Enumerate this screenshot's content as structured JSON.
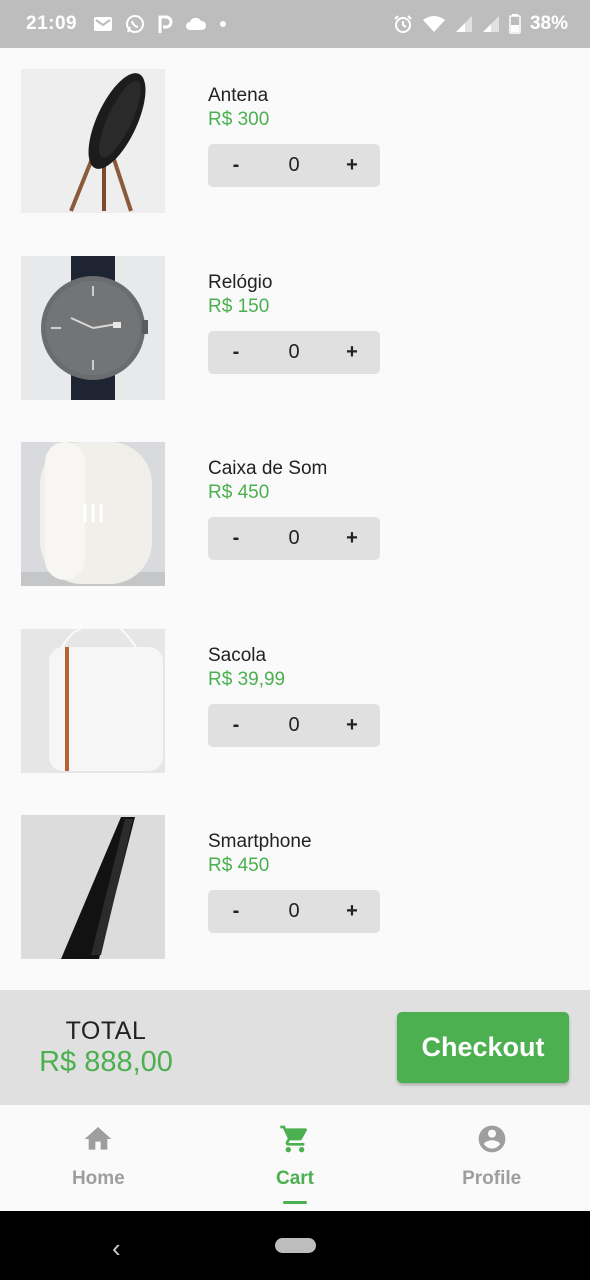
{
  "status_bar": {
    "time": "21:09",
    "battery_percent": "38%",
    "left_icons": [
      "gmail-icon",
      "whatsapp-icon",
      "p-app-icon",
      "cloud-icon",
      "dot-icon"
    ],
    "right_icons": [
      "alarm-icon",
      "wifi-icon",
      "signal-icon",
      "signal-icon",
      "battery-icon"
    ]
  },
  "products": [
    {
      "name": "Antena",
      "price": "R$ 300",
      "quantity": "0",
      "minus": "-",
      "plus": "+"
    },
    {
      "name": "Relógio",
      "price": "R$ 150",
      "quantity": "0",
      "minus": "-",
      "plus": "+"
    },
    {
      "name": "Caixa de Som",
      "price": "R$ 450",
      "quantity": "0",
      "minus": "-",
      "plus": "+"
    },
    {
      "name": "Sacola",
      "price": "R$ 39,99",
      "quantity": "0",
      "minus": "-",
      "plus": "+"
    },
    {
      "name": "Smartphone",
      "price": "R$ 450",
      "quantity": "0",
      "minus": "-",
      "plus": "+"
    }
  ],
  "total": {
    "label": "TOTAL",
    "value": "R$ 888,00"
  },
  "checkout_label": "Checkout",
  "bottom_nav": {
    "home": "Home",
    "cart": "Cart",
    "profile": "Profile",
    "active": "cart"
  },
  "colors": {
    "accent": "#4caf50",
    "surface": "#fafafa",
    "panel": "#e0e0e0",
    "status_bar": "#bdbdbd"
  }
}
